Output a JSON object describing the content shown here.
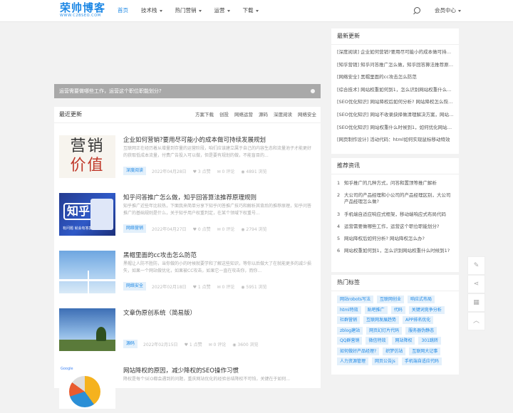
{
  "header": {
    "logo": "荣帅博客",
    "logo_sub": "WWW.C2BSEO.COM",
    "nav": [
      {
        "label": "首页",
        "active": true,
        "dropdown": false
      },
      {
        "label": "技术栈",
        "active": false,
        "dropdown": true
      },
      {
        "label": "热门营销",
        "active": false,
        "dropdown": true
      },
      {
        "label": "运营",
        "active": false,
        "dropdown": true
      },
      {
        "label": "下载",
        "active": false,
        "dropdown": true
      }
    ],
    "member": "会员中心"
  },
  "banner": {
    "text": "运营需要做哪些工作，运营这个职位职能划分?"
  },
  "main": {
    "title": "最近更新",
    "tabs": [
      "方案下载",
      "创投",
      "网络运营",
      "源码",
      "深度阅读",
      "网络安全"
    ],
    "posts": [
      {
        "title": "企业如何营销?要用尽可能小的成本做可持续发展规划",
        "excerpt": "互联网正在经历着从增量到存量的运营阶段，咱们应该建立属于自己的内容生态和流量池子才能更好的获取低成本流量，付费广告投入可以做，但是要有规划的做，不能盲目的...",
        "tag": "深度阅读",
        "date": "2022年04月28日",
        "likes": "3 点赞",
        "comments": "0 评论",
        "views": "4891 浏览",
        "thumb_text": [
          "营销",
          "价值"
        ]
      },
      {
        "title": "知乎问答推广怎么做，知乎回答算法推荐原理规则",
        "excerpt": "知乎推广近些年比较热，下面我来简单分享下知乎问答推广技巧和解析其背后的推荐原理，知乎问答推广的基础规则是什么，关于知乎用户权重判定，在某个领域下权重号...",
        "tag": "网络营销",
        "date": "2022年04月27日",
        "likes": "0 点赞",
        "comments": "0 评论",
        "views": "2794 浏览",
        "thumb_text": [
          "知乎",
          "有问题 就会有答案"
        ]
      },
      {
        "title": "黑帽里面的cc攻击怎么防范",
        "excerpt": "黑帽让人防不胜防，当你做的小的时候就要学和了解这些知识，等你以后做大了在就能更多的减少损失，如果一个网站做优化，如果被CC攻击，如果它一直在攻击你，而你...",
        "tag": "网络安全",
        "date": "2022年02月18日",
        "likes": "1 点赞",
        "comments": "0 评论",
        "views": "5951 浏览"
      },
      {
        "title": "文章伪原创系统（简易版）",
        "excerpt": "",
        "tag": "源码",
        "date": "2022年02月15日",
        "likes": "1 点赞",
        "comments": "0 评论",
        "views": "3600 浏览"
      },
      {
        "title": "网站降权的原因，减少降权的SEO操作习惯",
        "excerpt": "降权是每个SEO都会遇到的问题，重庆网站优化的经验总结降权不可怕，关键在于如何...",
        "tag": "",
        "date": "",
        "likes": "",
        "comments": "",
        "views": ""
      }
    ]
  },
  "sidebar": {
    "latest": {
      "title": "最新更新",
      "items": [
        "[深度阅读] 企业如何营销?要用尽可能小的成本做可持续发展规划",
        "[知乎营销] 知乎问答推广怎么做，知乎回答算法推荐原理规则",
        "[网络安全] 黑帽里面的cc攻击怎么防范",
        "[综合技术] 网站权重如何到1，怎么识别网站权重什么时候到1?",
        "[SEO优化知识] 网站降权后如何分析? 网站降权怎么恢复?",
        "[SEO优化知识] 网站不收录抉择做清理解决方案，网站收录问题",
        "[SEO优化知识] 网站权重什么时候到1，如何优化网站权重",
        "[网页制作设计] 活动代码：html如何实现鼠标移动特效"
      ]
    },
    "recommend": {
      "title": "推荐资讯",
      "items": [
        {
          "num": "1",
          "text": "知乎推广的几种方式，问答和置顶等推广解析"
        },
        {
          "num": "2",
          "text": "大公司的产品经理和小公司的产品经理区别，大公司产品经理怎么做?"
        },
        {
          "num": "3",
          "text": "手机端自适应响应式框架，移动端响应式布局代码"
        },
        {
          "num": "4",
          "text": "运营需要做哪些工作，运营这个职位职能划分?"
        },
        {
          "num": "5",
          "text": "网站降权后如何分析? 网站降权怎么办?"
        },
        {
          "num": "6",
          "text": "网站权重如何到1，怎么识别网站权重什么时候到1?"
        }
      ]
    },
    "hot_tags": {
      "title": "热门标签",
      "items": [
        "网站robots写法",
        "互联网创业",
        "响应式布局",
        "html特效",
        "贴吧推广",
        "代码",
        "关键词竞争分析",
        "社群营销",
        "互联网发展趋势",
        "APP排名优化",
        "zblog建站",
        "网页幻灯片代码",
        "服务器伪静态",
        "QQ群营销",
        "微信特效",
        "网站降权",
        "301跳转",
        "如何做好产品经理?",
        "织梦仿站",
        "互联网大记事",
        "人力资源管理",
        "网页公告js",
        "手机端自适应代码"
      ]
    }
  },
  "tools": [
    {
      "icon": "edit-icon",
      "glyph": "✎"
    },
    {
      "icon": "share-icon",
      "glyph": "⋖"
    },
    {
      "icon": "qrcode-icon",
      "glyph": "▦"
    },
    {
      "icon": "back-to-top-icon",
      "glyph": "︿"
    }
  ]
}
